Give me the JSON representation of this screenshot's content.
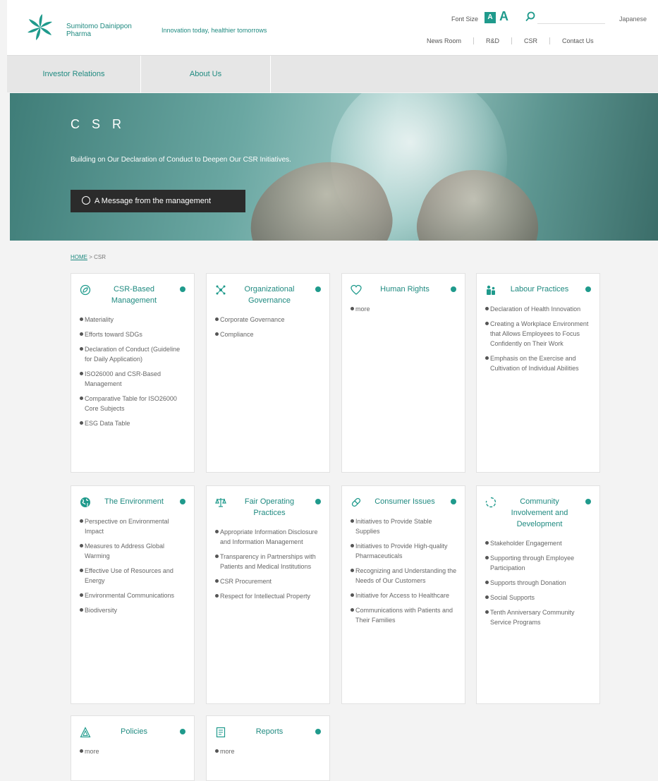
{
  "header": {
    "logo_line1": "Sumitomo Dainippon",
    "logo_line2": "Pharma",
    "tagline": "Innovation today, healthier tomorrows",
    "font_size_label": "Font Size",
    "font_small": "A",
    "font_large": "A",
    "search_placeholder": "",
    "language": "Japanese",
    "utility_nav": [
      "News Room",
      "R&D",
      "CSR",
      "Contact Us"
    ]
  },
  "global_nav": [
    "Investor Relations",
    "About Us"
  ],
  "hero": {
    "title": "C S R",
    "subtitle": "Building on Our Declaration of Conduct to Deepen Our CSR Initiatives.",
    "button_label": "A Message from the management"
  },
  "breadcrumb": {
    "home": "HOME",
    "separator": ">",
    "current": "CSR"
  },
  "cards": [
    {
      "title": "CSR-Based Management",
      "icon": "leaf-circle-icon",
      "items": [
        "Materiality",
        "Efforts toward SDGs",
        "Declaration of Conduct (Guideline for Daily Application)",
        "ISO26000 and CSR-Based Management",
        "Comparative Table for ISO26000 Core Subjects",
        "ESG Data Table"
      ]
    },
    {
      "title": "Organizational Governance",
      "icon": "network-icon",
      "items": [
        "Corporate Governance",
        "Compliance"
      ]
    },
    {
      "title": "Human Rights",
      "icon": "heart-icon",
      "items": [
        "more"
      ]
    },
    {
      "title": "Labour Practices",
      "icon": "people-icon",
      "items": [
        "Declaration of Health Innovation",
        "Creating a Workplace Environment that Allows Employees to Focus Confidently on Their Work",
        "Emphasis on the Exercise and Cultivation of Individual Abilities"
      ]
    },
    {
      "title": "The Environment",
      "icon": "globe-icon",
      "items": [
        "Perspective on Environmental Impact",
        "Measures to Address Global Warming",
        "Effective Use of Resources and Energy",
        "Environmental Communications",
        "Biodiversity"
      ]
    },
    {
      "title": "Fair Operating Practices",
      "icon": "scales-icon",
      "items": [
        "Appropriate Information Disclosure and Information Management",
        "Transparency in Partnerships with Patients and Medical Institutions",
        "CSR Procurement",
        "Respect for Intellectual Property"
      ]
    },
    {
      "title": "Consumer Issues",
      "icon": "capsule-icon",
      "items": [
        "Initiatives to Provide Stable Supplies",
        "Initiatives to Provide High-quality Pharmaceuticals",
        "Recognizing and Understanding the Needs of Our Customers",
        "Initiative for Access to Healthcare",
        "Communications with Patients and Their Families"
      ]
    },
    {
      "title": "Community Involvement and Development",
      "icon": "ring-icon",
      "items": [
        "Stakeholder Engagement",
        "Supporting through Employee Participation",
        "Supports through Donation",
        "Social Supports",
        "Tenth Anniversary Community Service Programs"
      ]
    },
    {
      "title": "Policies",
      "icon": "triangle-icon",
      "items": [
        "more"
      ]
    },
    {
      "title": "Reports",
      "icon": "document-icon",
      "items": [
        "more"
      ]
    }
  ],
  "colors": {
    "brand": "#1f8a80",
    "accent": "#1f9a8c"
  }
}
